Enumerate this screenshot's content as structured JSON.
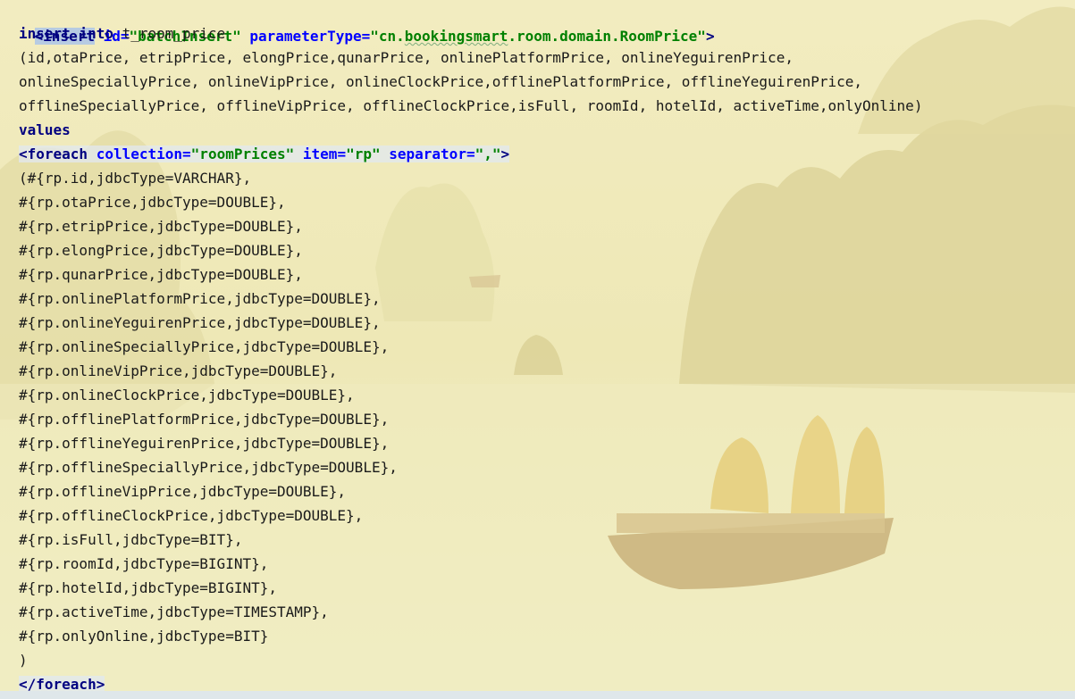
{
  "editor": {
    "line1": {
      "tag_open": "<insert",
      "attr_id": "id=",
      "val_id": "\"batchInsert\"",
      "attr_param": "parameterType=",
      "val_param_q1": "\"cn.",
      "val_param_pkg": "bookingsmart",
      "val_param_rest": ".room.domain.RoomPrice\"",
      "tag_close": ">"
    },
    "line2": {
      "kw1": "insert",
      "kw2": "into",
      "table": " t_room_price"
    },
    "line3": "(id,otaPrice, etripPrice, elongPrice,qunarPrice, onlinePlatformPrice, onlineYeguirenPrice,",
    "line4": "onlineSpeciallyPrice, onlineVipPrice, onlineClockPrice,offlinePlatformPrice, offlineYeguirenPrice,",
    "line5": "offlineSpeciallyPrice, offlineVipPrice, offlineClockPrice,isFull, roomId, hotelId, activeTime,onlyOnline)",
    "line6": "values",
    "line7": {
      "tag_open": "<foreach",
      "attr_collection": "collection=",
      "val_collection": "\"roomPrices\"",
      "attr_item": "item=",
      "val_item": "\"rp\"",
      "attr_sep": "separator=",
      "val_sep": "\",\"",
      "tag_close": ">"
    },
    "values": [
      "(#{rp.id,jdbcType=VARCHAR},",
      "#{rp.otaPrice,jdbcType=DOUBLE},",
      "#{rp.etripPrice,jdbcType=DOUBLE},",
      "#{rp.elongPrice,jdbcType=DOUBLE},",
      "#{rp.qunarPrice,jdbcType=DOUBLE},",
      "#{rp.onlinePlatformPrice,jdbcType=DOUBLE},",
      "#{rp.onlineYeguirenPrice,jdbcType=DOUBLE},",
      "#{rp.onlineSpeciallyPrice,jdbcType=DOUBLE},",
      "#{rp.onlineVipPrice,jdbcType=DOUBLE},",
      "#{rp.onlineClockPrice,jdbcType=DOUBLE},",
      "#{rp.offlinePlatformPrice,jdbcType=DOUBLE},",
      "#{rp.offlineYeguirenPrice,jdbcType=DOUBLE},",
      "#{rp.offlineSpeciallyPrice,jdbcType=DOUBLE},",
      "#{rp.offlineVipPrice,jdbcType=DOUBLE},",
      "#{rp.offlineClockPrice,jdbcType=DOUBLE},",
      "#{rp.isFull,jdbcType=BIT},",
      "#{rp.roomId,jdbcType=BIGINT},",
      "#{rp.hotelId,jdbcType=BIGINT},",
      "#{rp.activeTime,jdbcType=TIMESTAMP},",
      "#{rp.onlyOnline,jdbcType=BIT}",
      ")"
    ],
    "foreach_close": "</foreach>"
  },
  "colors": {
    "tag": "#000080",
    "attribute": "#0000ff",
    "string": "#008000",
    "text": "#1a1a1a",
    "tag_highlight": "#b7cbe2"
  }
}
